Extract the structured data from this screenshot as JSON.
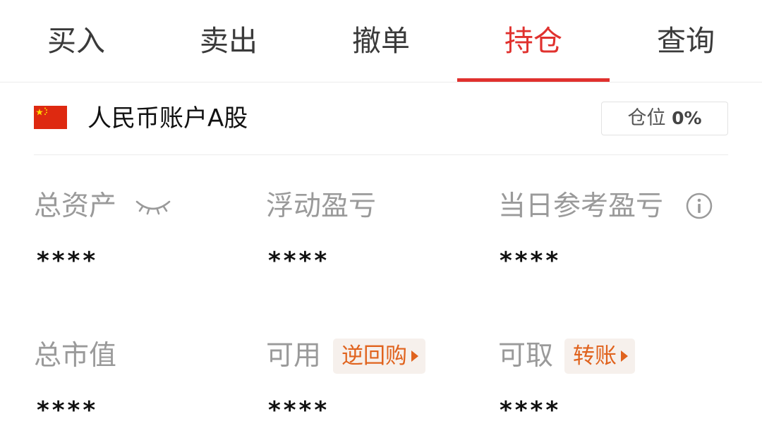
{
  "tabs": [
    {
      "label": "买入"
    },
    {
      "label": "卖出"
    },
    {
      "label": "撤单"
    },
    {
      "label": "持仓"
    },
    {
      "label": "查询"
    }
  ],
  "active_tab": "持仓",
  "account": {
    "name": "人民币账户A股",
    "flag_icon": "china-flag-icon",
    "position_label": "仓位",
    "position_value": "0%"
  },
  "stats": {
    "total_assets": {
      "label": "总资产",
      "value": "****",
      "icon": "eye-closed-icon"
    },
    "floating_pnl": {
      "label": "浮动盈亏",
      "value": "****"
    },
    "daily_pnl": {
      "label": "当日参考盈亏",
      "value": "****",
      "icon": "info-icon"
    },
    "market_value": {
      "label": "总市值",
      "value": "****"
    },
    "available": {
      "label": "可用",
      "value": "****",
      "action": "逆回购"
    },
    "withdrawable": {
      "label": "可取",
      "value": "****",
      "action": "转账"
    }
  },
  "colors": {
    "accent": "#e0312e",
    "chip_text": "#e0631e",
    "chip_bg": "#f6f0ec",
    "label_gray": "#9a9a9a"
  }
}
